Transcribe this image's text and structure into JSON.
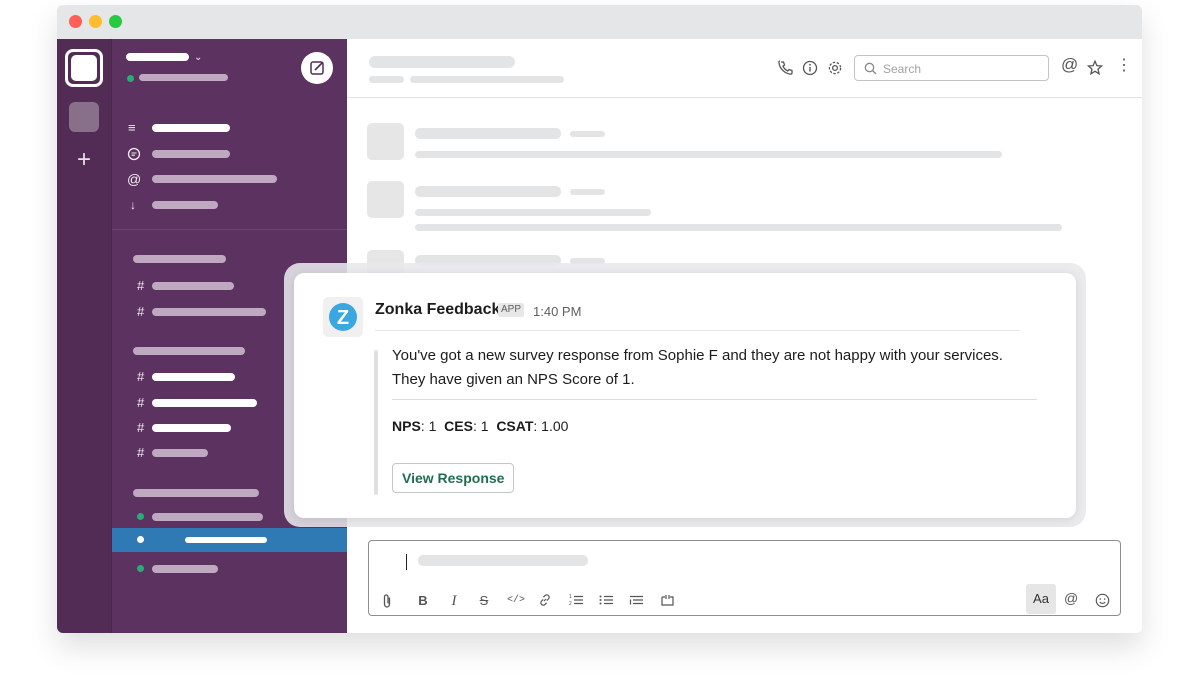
{
  "window": {
    "search_placeholder": "Search"
  },
  "composer": {
    "format_icons": [
      "paperclip-icon",
      "bold-icon",
      "italic-icon",
      "strikethrough-icon",
      "code-icon",
      "link-icon",
      "ordered-list-icon",
      "bulleted-list-icon",
      "blockquote-icon",
      "code-block-icon"
    ],
    "aa_label": "Aa"
  },
  "message": {
    "sender": "Zonka Feedback",
    "badge": "APP",
    "time": "1:40 PM",
    "logo_letter": "Z",
    "text_line1": "You've got a new survey response from Sophie F and they are not happy with your services.",
    "text_line2": "They have given an NPS Score of 1.",
    "fields": [
      {
        "label": "NPS",
        "value": "1"
      },
      {
        "label": "CES",
        "value": "1"
      },
      {
        "label": "CSAT",
        "value": "1.00"
      }
    ],
    "button_label": "View Response"
  },
  "colors": {
    "sidebar": "#5c3260",
    "rail": "#532c55",
    "selected_row": "#2f7ab4",
    "presence": "#2bac76",
    "button_text": "#1f6f4d",
    "logo_accent": "#3aa7e0"
  }
}
